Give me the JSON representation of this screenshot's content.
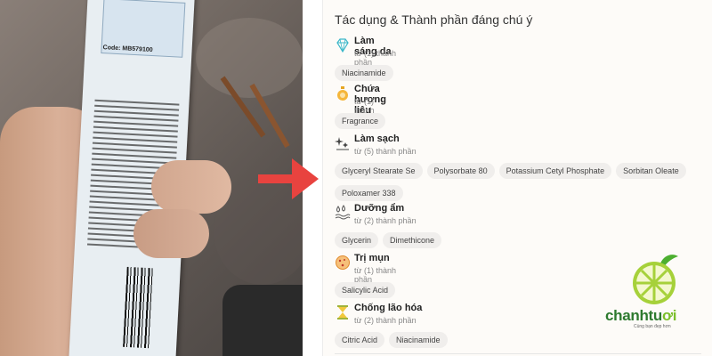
{
  "photo": {
    "product_code": "Code: MB579100"
  },
  "panel": {
    "title": "Tác dụng & Thành phần đáng chú ý",
    "groups": [
      {
        "title": "Làm sáng da",
        "count": "từ (1) thành phần",
        "icon": "diamond-icon",
        "chips": [
          "Niacinamide"
        ]
      },
      {
        "title": "Chứa hương liệu",
        "count": "từ (1) thành phần",
        "icon": "perfume-bottle-icon",
        "chips": [
          "Fragrance"
        ]
      },
      {
        "title": "Làm sạch",
        "count": "từ (5) thành phần",
        "icon": "sparkle-clean-icon",
        "chips": [
          "Glyceryl Stearate Se",
          "Polysorbate 80",
          "Potassium Cetyl Phosphate",
          "Sorbitan Oleate",
          "Poloxamer 338"
        ]
      },
      {
        "title": "Dưỡng ẩm",
        "count": "từ (2) thành phần",
        "icon": "water-drops-icon",
        "chips": [
          "Glycerin",
          "Dimethicone"
        ]
      },
      {
        "title": "Trị mụn",
        "count": "từ (1) thành phần",
        "icon": "acne-icon",
        "chips": [
          "Salicylic Acid"
        ]
      },
      {
        "title": "Chống lão hóa",
        "count": "từ (2) thành phần",
        "icon": "hourglass-icon",
        "chips": [
          "Citric Acid",
          "Niacinamide"
        ]
      }
    ]
  },
  "logo": {
    "name_main": "chanhtu",
    "name_accent": "ơi",
    "tagline": "Cùng bạn đẹp hơn"
  },
  "colors": {
    "arrow": "#e8433f",
    "brand_green": "#2d7a2f",
    "lime": "#a6d13a"
  }
}
